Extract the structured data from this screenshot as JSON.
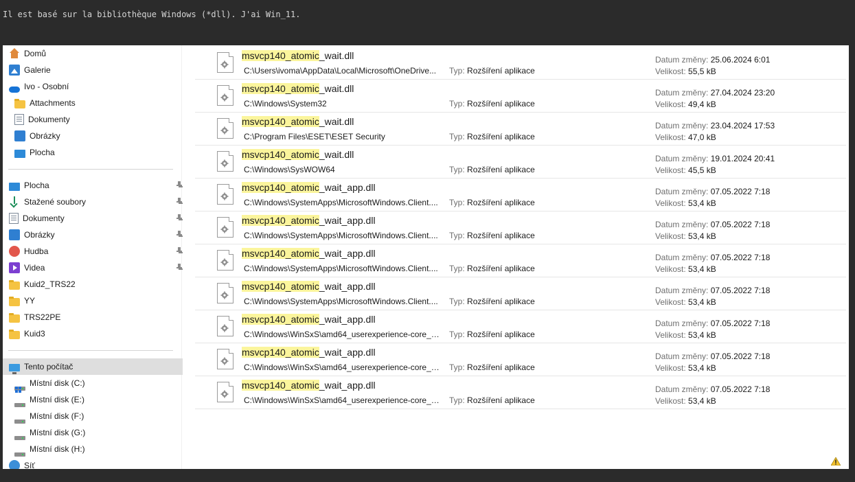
{
  "message": "Il est basé sur la bibliothèque Windows (*dll). J'ai Win_11.",
  "sidebar": {
    "items": [
      {
        "label": "Domů",
        "icon": "home-icon"
      },
      {
        "label": "Galerie",
        "icon": "gallery-icon"
      },
      {
        "label": "Ivo - Osobní",
        "icon": "onedrive-cloud-icon"
      },
      {
        "label": "Attachments",
        "icon": "folder-icon"
      },
      {
        "label": "Dokumenty",
        "icon": "document-icon"
      },
      {
        "label": "Obrázky",
        "icon": "pictures-icon"
      },
      {
        "label": "Plocha",
        "icon": "desktop-icon"
      },
      {
        "label": "Plocha",
        "icon": "desktop-icon",
        "pinned": true
      },
      {
        "label": "Stažené soubory",
        "icon": "download-icon",
        "pinned": true
      },
      {
        "label": "Dokumenty",
        "icon": "document-icon",
        "pinned": true
      },
      {
        "label": "Obrázky",
        "icon": "pictures-icon",
        "pinned": true
      },
      {
        "label": "Hudba",
        "icon": "music-icon",
        "pinned": true
      },
      {
        "label": "Videa",
        "icon": "video-icon",
        "pinned": true
      },
      {
        "label": "Kuid2_TRS22",
        "icon": "folder-icon"
      },
      {
        "label": "YY",
        "icon": "folder-icon"
      },
      {
        "label": "TRS22PE",
        "icon": "folder-icon"
      },
      {
        "label": "Kuid3",
        "icon": "folder-icon"
      },
      {
        "label": "Tento počítač",
        "icon": "computer-icon",
        "selected": true
      },
      {
        "label": "Místní disk (C:)",
        "icon": "system-drive-icon"
      },
      {
        "label": "Místní disk (E:)",
        "icon": "drive-icon"
      },
      {
        "label": "Místní disk (F:)",
        "icon": "drive-icon"
      },
      {
        "label": "Místní disk (G:)",
        "icon": "drive-icon"
      },
      {
        "label": "Místní disk (H:)",
        "icon": "drive-icon"
      },
      {
        "label": "Síť",
        "icon": "network-icon"
      }
    ]
  },
  "labels": {
    "type": "Typ:",
    "date": "Datum změny:",
    "size": "Velikost:"
  },
  "results": [
    {
      "highlight": "msvcp140_atomic",
      "rest": "_wait.dll",
      "path": "C:\\Users\\ivoma\\AppData\\Local\\Microsoft\\OneDrive...",
      "type": "Rozšíření aplikace",
      "date": "25.06.2024 6:01",
      "size": "55,5 kB"
    },
    {
      "highlight": "msvcp140_atomic",
      "rest": "_wait.dll",
      "path": "C:\\Windows\\System32",
      "type": "Rozšíření aplikace",
      "date": "27.04.2024 23:20",
      "size": "49,4 kB"
    },
    {
      "highlight": "msvcp140_atomic",
      "rest": "_wait.dll",
      "path": "C:\\Program Files\\ESET\\ESET Security",
      "type": "Rozšíření aplikace",
      "date": "23.04.2024 17:53",
      "size": "47,0 kB"
    },
    {
      "highlight": "msvcp140_atomic",
      "rest": "_wait.dll",
      "path": "C:\\Windows\\SysWOW64",
      "type": "Rozšíření aplikace",
      "date": "19.01.2024 20:41",
      "size": "45,5 kB"
    },
    {
      "highlight": "msvcp140_atomic",
      "rest": "_wait_app.dll",
      "path": "C:\\Windows\\SystemApps\\MicrosoftWindows.Client....",
      "type": "Rozšíření aplikace",
      "date": "07.05.2022 7:18",
      "size": "53,4 kB"
    },
    {
      "highlight": "msvcp140_atomic",
      "rest": "_wait_app.dll",
      "path": "C:\\Windows\\SystemApps\\MicrosoftWindows.Client....",
      "type": "Rozšíření aplikace",
      "date": "07.05.2022 7:18",
      "size": "53,4 kB"
    },
    {
      "highlight": "msvcp140_atomic",
      "rest": "_wait_app.dll",
      "path": "C:\\Windows\\SystemApps\\MicrosoftWindows.Client....",
      "type": "Rozšíření aplikace",
      "date": "07.05.2022 7:18",
      "size": "53,4 kB"
    },
    {
      "highlight": "msvcp140_atomic",
      "rest": "_wait_app.dll",
      "path": "C:\\Windows\\SystemApps\\MicrosoftWindows.Client....",
      "type": "Rozšíření aplikace",
      "date": "07.05.2022 7:18",
      "size": "53,4 kB"
    },
    {
      "highlight": "msvcp140_atomic",
      "rest": "_wait_app.dll",
      "path": "C:\\Windows\\WinSxS\\amd64_userexperience-core_3...",
      "type": "Rozšíření aplikace",
      "date": "07.05.2022 7:18",
      "size": "53,4 kB"
    },
    {
      "highlight": "msvcp140_atomic",
      "rest": "_wait_app.dll",
      "path": "C:\\Windows\\WinSxS\\amd64_userexperience-core_3...",
      "type": "Rozšíření aplikace",
      "date": "07.05.2022 7:18",
      "size": "53,4 kB"
    },
    {
      "highlight": "msvcp140_atomic",
      "rest": "_wait_app.dll",
      "path": "C:\\Windows\\WinSxS\\amd64_userexperience-core_3...",
      "type": "Rozšíření aplikace",
      "date": "07.05.2022 7:18",
      "size": "53,4 kB"
    }
  ],
  "colors": {
    "highlight": "#fbf59c",
    "selected": "#dedede",
    "accent": "#1673d6"
  },
  "status_icon": "warning-icon"
}
